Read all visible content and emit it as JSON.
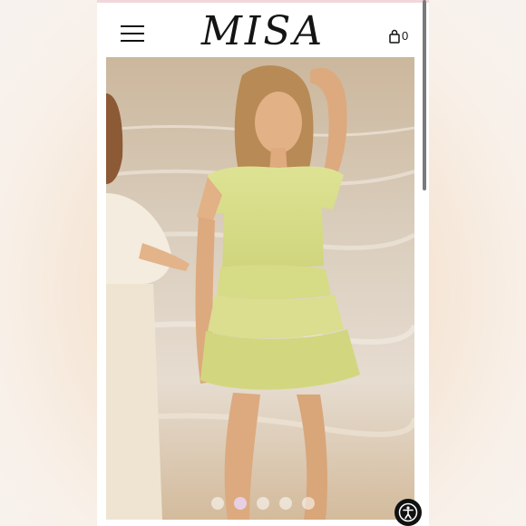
{
  "header": {
    "brand": "MISA",
    "cart_count": "0"
  },
  "carousel": {
    "slide_count": 5,
    "active_index": 1
  },
  "icons": {
    "menu": "hamburger-menu-icon",
    "cart": "shopping-bag-icon",
    "accessibility": "accessibility-icon"
  },
  "colors": {
    "dress": "#d8dc8a",
    "background": "#f6e6d6"
  }
}
